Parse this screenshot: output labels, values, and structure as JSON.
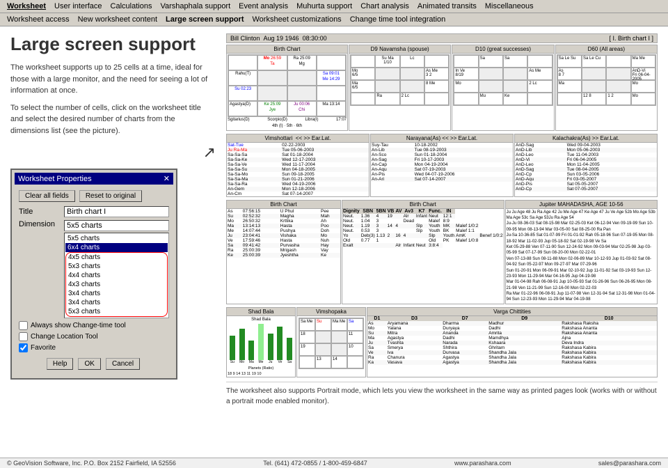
{
  "topMenu": {
    "items": [
      "Worksheet",
      "User interface",
      "Calculations",
      "Varshaphala support",
      "Event analysis",
      "Muhurta support",
      "Chart analysis",
      "Animated transits",
      "Miscellaneous"
    ]
  },
  "subMenu": {
    "items": [
      "Worksheet access",
      "New worksheet content",
      "Large screen support",
      "Worksheet customizations",
      "Change time tool integration"
    ]
  },
  "page": {
    "title": "Large screen support",
    "description1": "The worksheet supports up to 25 cells at a time, ideal for those with a large monitor, and the need for seeing a lot of information at once.",
    "description2": "To select the number of cells, click on the worksheet title and select the desired number of charts from the dimensions list (see the picture).",
    "portraitNote": "The worksheet also supports Portrait mode, which lets you view the worksheet in the same way as printed pages look (works with or without a portrait mode enabled monitor)."
  },
  "dialog": {
    "title": "Worksheet Properties",
    "clearBtn": "Clear all fields",
    "resetBtn": "Reset to original",
    "titleLabel": "Title",
    "titleValue": "Birth chart I",
    "dimensionLabel": "Dimension",
    "dimensionValue": "5x5 charts",
    "dimensionOptions": [
      "5x5 charts",
      "6x4 charts",
      "4x5 charts",
      "5x3 charts",
      "4x4 charts",
      "4x3 charts",
      "3x4 charts",
      "3x4 charts",
      "5x3 charts"
    ],
    "selectedOption": "6x4 charts",
    "circledOptions": [
      "4x5 charts",
      "5x3 charts",
      "4x4 charts",
      "4x3 charts",
      "3x4 charts",
      "3x4 charts",
      "5x3 charts"
    ],
    "checkbox1": "Always show Change-time tool",
    "checkbox2": "Change Location Tool",
    "checkbox3": "Favorite",
    "helpBtn": "Help",
    "okBtn": "OK",
    "cancelBtn": "Cancel"
  },
  "clintonHeader": {
    "name": "Bill Clinton",
    "birthDate": "Aug 19 1946  08:30:00",
    "chartLabel": "[ I. Birth chart I ]"
  },
  "charts": {
    "birthChart": {
      "label": "Birth Chart",
      "planets": [
        {
          "name": "Mo",
          "deg": "26:59",
          "sign": "Ta",
          "color": "red"
        },
        {
          "name": "Ra",
          "deg": "25:09",
          "sign": "Mg",
          "color": "normal"
        },
        {
          "name": "Sa",
          "deg": "09:01",
          "sign": "Pi",
          "color": "blue"
        },
        {
          "name": "Me",
          "deg": "14:29",
          "sign": "Pi",
          "color": "blue"
        },
        {
          "name": "Su",
          "deg": "02:23",
          "sign": "Le",
          "color": "normal"
        },
        {
          "name": "As",
          "deg": "07:56",
          "sign": "Li",
          "color": "normal"
        },
        {
          "name": "Ke",
          "deg": "25:09",
          "sign": "Sg",
          "color": "green"
        },
        {
          "name": "Ju",
          "deg": "00:06",
          "sign": "Ch",
          "color": "purple"
        },
        {
          "name": "Ma",
          "deg": "13:14",
          "sign": "Li",
          "color": "red"
        }
      ]
    },
    "d9": {
      "label": "D9 Navamsha (spouse)"
    },
    "d10": {
      "label": "D10 (great successes)"
    },
    "d60": {
      "label": "D60 (All areas)"
    }
  },
  "vimshottari": {
    "header": "Vimshottari",
    "columns": [
      "Sa",
      "Ra-Ma",
      "Sa-Sa-Sa",
      "Sa-Sa-Ke",
      "Sa-Sa-Ve",
      "Sa-Sa-Su",
      "Sa-Sa-Mo",
      "Sa-Sa-Ma",
      "Sa-Sa-Ra"
    ],
    "rows": [
      [
        "Sat-Tue",
        "02-22-2003",
        "",
        ""
      ],
      [
        "Jup-Ra-Ma",
        "Tue 05-06-2003",
        "",
        ""
      ],
      [
        "An-Sco",
        "Sat 01-18-2004",
        "",
        ""
      ],
      [
        "AnD-Sag",
        "Wed 12-17-2003",
        "",
        ""
      ],
      [
        "An-Cap",
        "Wed 11-17-2004",
        "",
        ""
      ],
      [
        "AnD-Aqu",
        "Mon 04-18-2005",
        "",
        ""
      ],
      [
        "An-Pis",
        "Sun 09-18-2005",
        "",
        ""
      ],
      [
        "AnD-Sag",
        "Sun 01-21-2006",
        "",
        ""
      ],
      [
        "AnD-Aqu",
        "Wed 04-19-2006",
        "",
        ""
      ],
      [
        "AnD-Cp",
        "Fri 03-05-2007",
        "",
        ""
      ],
      [
        "An-Gem",
        "Mon 12-18-2006",
        "",
        ""
      ],
      [
        "An-Cm",
        "Sat 07-14-2007",
        "",
        ""
      ]
    ]
  },
  "shadBala": {
    "title": "Shad Bala",
    "planets": [
      "Su",
      "Mo",
      "Ma",
      "Me",
      "Ju",
      "Ve",
      "Sa"
    ],
    "values": [
      55,
      70,
      45,
      80,
      60,
      75,
      50
    ]
  },
  "vimshopaka": {
    "title": "Vimshopaka"
  },
  "vargaTable": {
    "title": "Varga Chittities",
    "headers": [
      "D1",
      "D3",
      "D7",
      "D9",
      "D10"
    ],
    "rows": [
      [
        "As",
        "Aryamana",
        "Dharma",
        "Madhur",
        "Rakshasa",
        "Raksha"
      ],
      [
        "Mo",
        "Yalana",
        "Duryaya",
        "Dadhi",
        "Rakshasa",
        "Ananta"
      ],
      [
        "Su",
        "Mitra",
        "Ananda",
        "Amrita",
        "Rakshasa",
        "Ananta"
      ],
      [
        "Ma",
        "Agastya",
        "Dadhi",
        "Mamdhya",
        "Ajna"
      ],
      [
        "Ju",
        "Tvashta",
        "Narada",
        "Kshaara",
        "Deva",
        "Indra"
      ],
      [
        "Sa",
        "Smerya",
        "Shthira",
        "Ghritam",
        "Rakshasa",
        "Kabira"
      ],
      [
        "Ve",
        "Iva",
        "Durvasa",
        "Shandha",
        "Jala",
        "Rakshasa",
        "Kabira"
      ],
      [
        "Ra",
        "Chanura",
        "Agastya",
        "Shandha",
        "Jala",
        "Rakshasa",
        "Kabira"
      ],
      [
        "Ka",
        "Vasava",
        "Agastya",
        "Shandha",
        "Jala",
        "Rakshasa",
        "Kabira"
      ]
    ]
  },
  "footer": {
    "copyright": "© GeoVision Software, Inc. P.O. Box 2152 Fairfield, IA 52556",
    "phone": "Tel. (641) 472-0855 / 1-800-459-6847",
    "website": "www.parashara.com",
    "email": "sales@parashara.com"
  }
}
